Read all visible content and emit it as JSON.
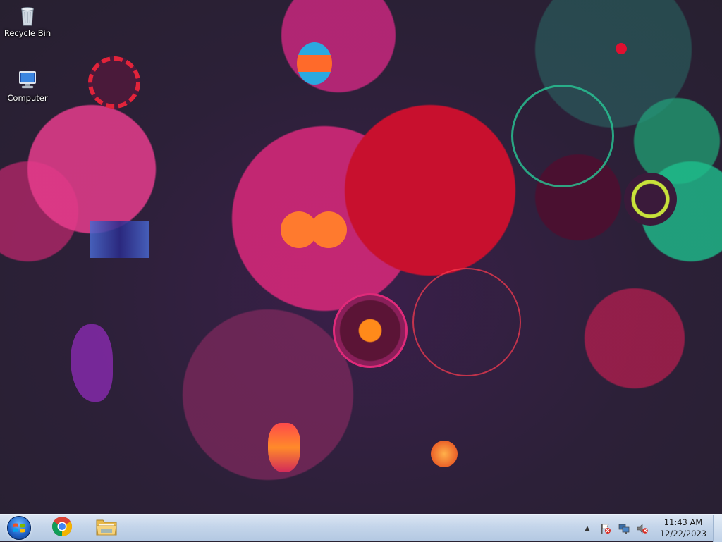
{
  "desktop": {
    "icons": [
      {
        "label": "Recycle Bin",
        "icon": "recycle-bin-icon"
      },
      {
        "label": "Computer",
        "icon": "computer-icon"
      }
    ]
  },
  "taskbar": {
    "start_icon": "windows-start-orb-icon",
    "pinned": [
      {
        "name": "chrome",
        "icon": "chrome-icon"
      },
      {
        "name": "file-explorer",
        "icon": "folder-icon"
      }
    ],
    "tray": {
      "show_hidden_label": "▲",
      "icons": [
        "action-center-flag-icon",
        "network-icon",
        "volume-muted-icon"
      ]
    },
    "clock": {
      "time": "11:43 AM",
      "date": "12/22/2023"
    }
  },
  "colors": {
    "taskbar_top": "#dbe6f3",
    "taskbar_bottom": "#b3c8e2",
    "wallpaper_base": "#2c2038"
  }
}
